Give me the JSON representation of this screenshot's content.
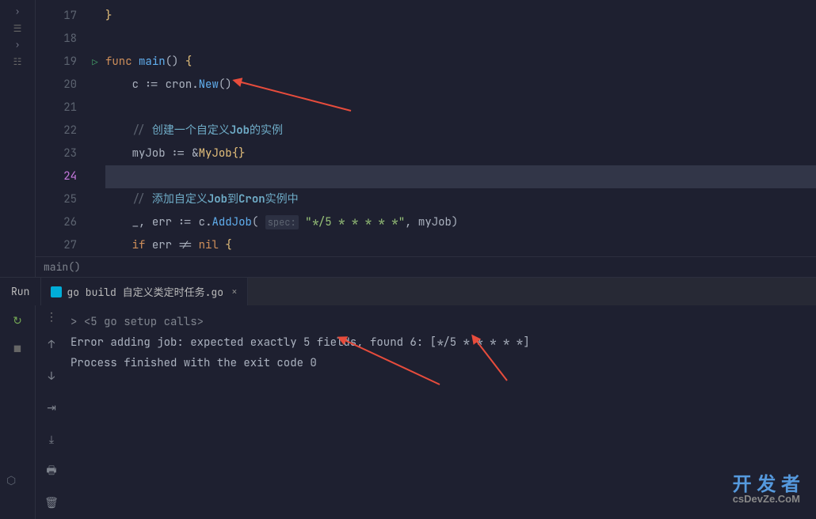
{
  "editor": {
    "lines": [
      {
        "num": 17,
        "highlighted": false
      },
      {
        "num": 18,
        "highlighted": false
      },
      {
        "num": 19,
        "highlighted": false,
        "hasRun": true
      },
      {
        "num": 20,
        "highlighted": false
      },
      {
        "num": 21,
        "highlighted": false
      },
      {
        "num": 22,
        "highlighted": false
      },
      {
        "num": 23,
        "highlighted": false
      },
      {
        "num": 24,
        "highlighted": true
      },
      {
        "num": 25,
        "highlighted": false
      },
      {
        "num": 26,
        "highlighted": false
      },
      {
        "num": 27,
        "highlighted": false
      }
    ],
    "code": {
      "l17": "}",
      "l19_func": "func",
      "l19_main": "main",
      "l19_parens": "()",
      "l19_brace": "{",
      "l20_c": "c",
      "l20_assign": ":=",
      "l20_cron": "cron",
      "l20_dot": ".",
      "l20_new": "New",
      "l20_call": "()",
      "l22_slash": "//",
      "l22_comment1": " 创建一个自定义",
      "l22_job": "Job",
      "l22_comment2": "的实例",
      "l23_myJob": "myJob",
      "l23_assign": ":=",
      "l23_amp": "&",
      "l23_type": "MyJob",
      "l23_braces": "{}",
      "l25_slash": "//",
      "l25_comment1": " 添加自定义",
      "l25_job": "Job",
      "l25_comment2": "到",
      "l25_cron": "Cron",
      "l25_comment3": "实例中",
      "l26_blank": "_",
      "l26_comma": ",",
      "l26_err": "err",
      "l26_assign": ":=",
      "l26_c": "c",
      "l26_dot": ".",
      "l26_addjob": "AddJob",
      "l26_open": "(",
      "l26_hint": "spec:",
      "l26_str": "\"*/5 * * * * *\"",
      "l26_comma2": ",",
      "l26_myjob": "myJob",
      "l26_close": ")",
      "l27_if": "if",
      "l27_err": "err",
      "l27_ne": "!=",
      "l27_nil": "nil",
      "l27_brace": "{"
    },
    "breadcrumb": "main()"
  },
  "runPanel": {
    "label": "Run",
    "tabName": "go build 自定义类定时任务.go",
    "output": {
      "line1_prefix": ">",
      "line1": "<5 go setup calls>",
      "line2": "Error adding job: expected exactly 5 fields, found 6: [*/5 * * * * *]",
      "line3": "Process finished with the exit code 0"
    }
  },
  "watermark": {
    "main": "开 发 者",
    "sub": "csDevZe.CoM"
  }
}
